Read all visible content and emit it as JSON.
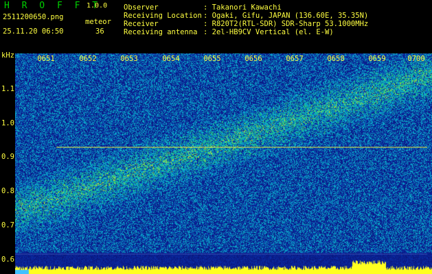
{
  "app": {
    "title": "H R O F F T",
    "version": "1.0.0"
  },
  "file": {
    "name": "2511200650.png",
    "datetime": "25.11.20 06:50"
  },
  "meteor": {
    "label": "meteor",
    "count": "36"
  },
  "info": [
    {
      "label": "Observer",
      "value": ": Takanori Kawachi"
    },
    {
      "label": "Receiving Location",
      "value": ": Ogaki, Gifu, JAPAN (136.60E, 35.35N)"
    },
    {
      "label": "Receiver",
      "value": ": R820T2(RTL-SDR) SDR-Sharp 53.1000MHz"
    },
    {
      "label": "Receiving antenna",
      "value": ": 2el-HB9CV Vertical (el. E-W)"
    }
  ],
  "axis": {
    "unit": "kHz",
    "hours": [
      "0651",
      "0652",
      "0653",
      "0654",
      "0655",
      "0656",
      "0657",
      "0658",
      "0659",
      "0700"
    ],
    "freqs": [
      "1.1",
      "1.0",
      "0.9",
      "0.8",
      "0.7",
      "0.6"
    ]
  },
  "colors": {
    "label": "#ffff40",
    "title": "#00d000",
    "background": "#0a1a8c"
  }
}
